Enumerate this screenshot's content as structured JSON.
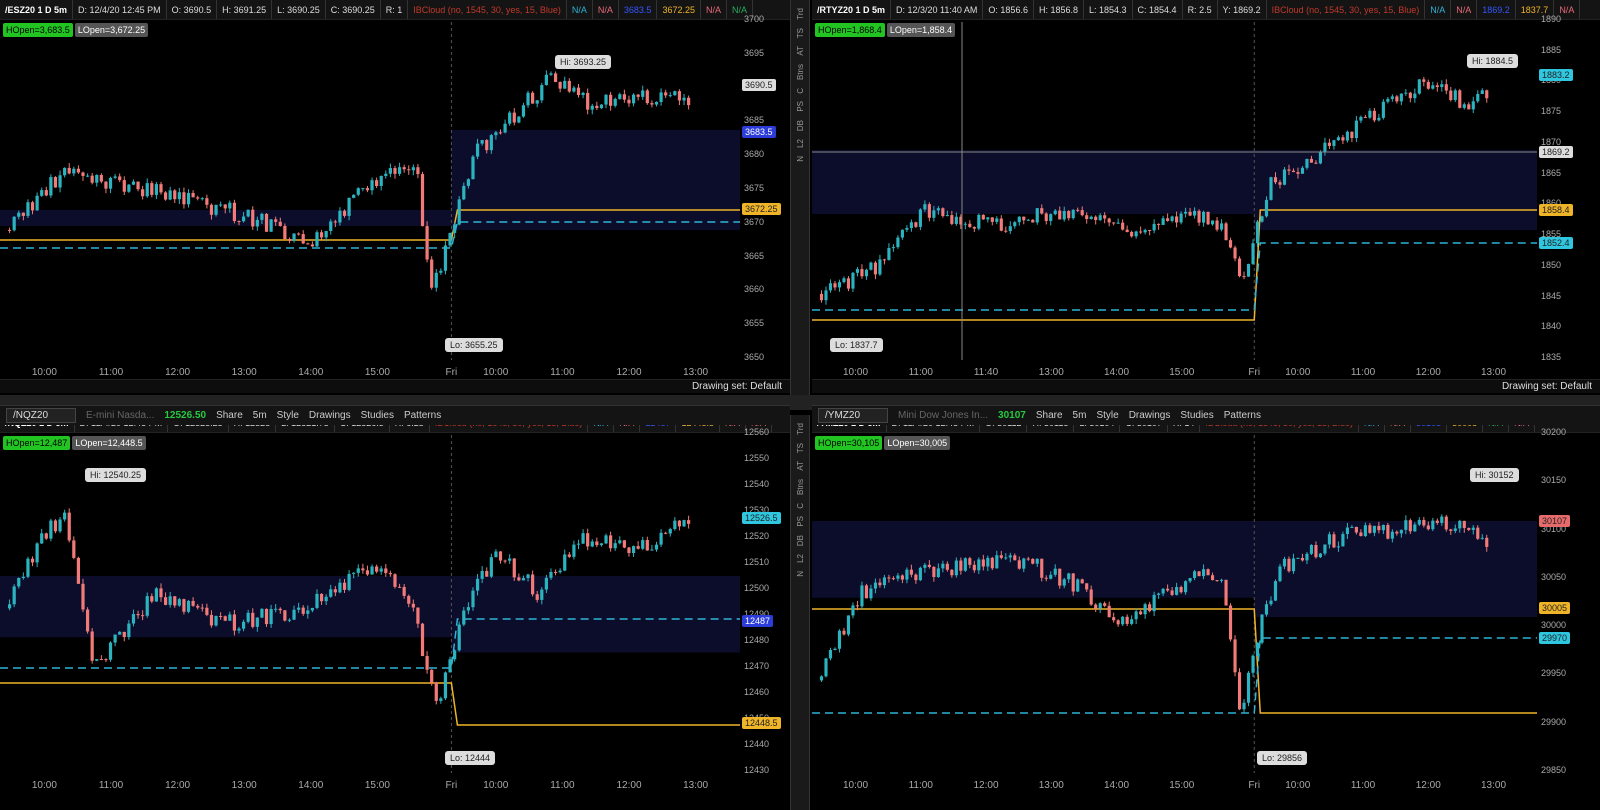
{
  "panes": [
    {
      "id": "es",
      "info": [
        "/ESZ20 1 D 5m",
        "D: 12/4/20 12:45 PM",
        "O: 3690.5",
        "H: 3691.25",
        "L: 3690.25",
        "C: 3690.25",
        "R: 1",
        "IBCloud (no, 1545, 30, yes, 15, Blue)",
        "N/A",
        "N/A",
        "3683.5",
        "3672.25",
        "N/A",
        "N/A"
      ],
      "info_colors": [
        "sym",
        "",
        "",
        "",
        "",
        "",
        "",
        "red",
        "cyan",
        "pink",
        "blue",
        "orange",
        "pink",
        "green"
      ],
      "hopen": "HOpen=3,683.5",
      "lopen": "LOpen=3,672.25",
      "hi": "Hi: 3693.25",
      "lo": "Lo: 3655.25",
      "yticks": [
        "3700",
        "3695",
        "3690",
        "3685",
        "3680",
        "3675",
        "3670",
        "3665",
        "3660",
        "3655",
        "3650"
      ],
      "xticks": [
        "10:00",
        "11:00",
        "12:00",
        "13:00",
        "14:00",
        "15:00",
        "Fri",
        "10:00",
        "11:00",
        "12:00",
        "13:00"
      ],
      "tags": [
        {
          "text": "3690.5",
          "bg": "#dddddd",
          "fg": "#222"
        },
        {
          "text": "3683.5",
          "bg": "#2b3cd8",
          "fg": "#fff"
        },
        {
          "text": "3672.25",
          "bg": "#f0b429",
          "fg": "#222"
        }
      ],
      "drawing_set": "Drawing set: Default"
    },
    {
      "id": "rty",
      "info": [
        "/RTYZ20 1 D 5m",
        "D: 12/3/20 11:40 AM",
        "O: 1856.6",
        "H: 1856.8",
        "L: 1854.3",
        "C: 1854.4",
        "R: 2.5",
        "Y: 1869.2",
        "IBCloud (no, 1545, 30, yes, 15, Blue)",
        "N/A",
        "N/A",
        "1869.2",
        "1837.7",
        "N/A"
      ],
      "info_colors": [
        "sym",
        "",
        "",
        "",
        "",
        "",
        "",
        "",
        "red",
        "cyan",
        "pink",
        "blue",
        "orange",
        "pink"
      ],
      "hopen": "HOpen=1,868.4",
      "lopen": "LOpen=1,858.4",
      "hi": "Hi: 1884.5",
      "lo": "Lo: 1837.7",
      "yticks": [
        "1890",
        "1885",
        "1880",
        "1875",
        "1870",
        "1865",
        "1860",
        "1855",
        "1850",
        "1845",
        "1840",
        "1835"
      ],
      "xticks": [
        "10:00",
        "11:00",
        "11:40",
        "13:00",
        "14:00",
        "15:00",
        "Fri",
        "10:00",
        "11:00",
        "12:00",
        "13:00"
      ],
      "tags": [
        {
          "text": "1883.2",
          "bg": "#2fc7e0",
          "fg": "#222"
        },
        {
          "text": "1869.2",
          "bg": "#dddddd",
          "fg": "#222"
        },
        {
          "text": "1858.4",
          "bg": "#f0b429",
          "fg": "#222"
        },
        {
          "text": "1852.4",
          "bg": "#2fc7e0",
          "fg": "#222"
        }
      ],
      "drawing_set": "Drawing set: Default"
    },
    {
      "id": "nq",
      "info": [
        "/NQZ20 1 D 5m",
        "D: 12/4/20 12:45 PM",
        "O: 12525.25",
        "H: 12528",
        "L: 12521.75",
        "C: 12526.5",
        "R: 6.25",
        "IBCloud (no, 1545, 30, yes, 15, Blue)",
        "N/A",
        "N/A",
        "12487",
        "12448.5",
        "N/A",
        "N/A"
      ],
      "info_colors": [
        "sym",
        "",
        "",
        "",
        "",
        "",
        "",
        "red",
        "cyan",
        "pink",
        "blue",
        "orange",
        "pink",
        "pink"
      ],
      "hopen": "HOpen=12,487",
      "lopen": "LOpen=12,448.5",
      "hi": "Hi: 12540.25",
      "lo": "Lo: 12444",
      "yticks": [
        "12560",
        "12550",
        "12540",
        "12530",
        "12520",
        "12510",
        "12500",
        "12490",
        "12480",
        "12470",
        "12460",
        "12450",
        "12440",
        "12430"
      ],
      "xticks": [
        "10:00",
        "11:00",
        "12:00",
        "13:00",
        "14:00",
        "15:00",
        "Fri",
        "10:00",
        "11:00",
        "12:00",
        "13:00"
      ],
      "tags": [
        {
          "text": "12526.5",
          "bg": "#2fc7e0",
          "fg": "#222"
        },
        {
          "text": "12487",
          "bg": "#2b3cd8",
          "fg": "#fff"
        },
        {
          "text": "12448.5",
          "bg": "#f0b429",
          "fg": "#222"
        }
      ],
      "toolbar": {
        "symbol": "/NQZ20",
        "desc": "E-mini Nasda...",
        "price": "12526.50",
        "share": "Share",
        "interval": "5m",
        "style": "Style",
        "drawings": "Drawings",
        "studies": "Studies",
        "patterns": "Patterns"
      }
    },
    {
      "id": "ym",
      "info": [
        "/YMZ20 1 D 5m",
        "D: 12/4/20 12:45 PM",
        "O: 30112",
        "H: 30118",
        "L: 30104",
        "C: 30107",
        "R: 14",
        "IBCloud (no, 1545, 30, yes, 15, Blue)",
        "N/A",
        "N/A",
        "30105",
        "30005",
        "N/A",
        "N/A"
      ],
      "info_colors": [
        "sym",
        "",
        "",
        "",
        "",
        "",
        "",
        "red",
        "cyan",
        "pink",
        "blue",
        "orange",
        "green",
        "pink"
      ],
      "hopen": "HOpen=30,105",
      "lopen": "LOpen=30,005",
      "hi": "Hi: 30152",
      "lo": "Lo: 29856",
      "yticks": [
        "30200",
        "30150",
        "30100",
        "30050",
        "30000",
        "29950",
        "29900",
        "29850"
      ],
      "xticks": [
        "10:00",
        "11:00",
        "12:00",
        "13:00",
        "14:00",
        "15:00",
        "Fri",
        "10:00",
        "11:00",
        "12:00",
        "13:00"
      ],
      "tags": [
        {
          "text": "30107",
          "bg": "#e86b6b",
          "fg": "#222"
        },
        {
          "text": "30005",
          "bg": "#f0b429",
          "fg": "#222"
        },
        {
          "text": "29970",
          "bg": "#2fc7e0",
          "fg": "#222"
        }
      ],
      "toolbar": {
        "symbol": "/YMZ20",
        "desc": "Mini Dow Jones In...",
        "price": "30107",
        "share": "Share",
        "interval": "5m",
        "style": "Style",
        "drawings": "Drawings",
        "studies": "Studies",
        "patterns": "Patterns"
      }
    }
  ],
  "sidebar_tabs": [
    "Trd",
    "TS",
    "AT",
    "Btns",
    "C",
    "PS",
    "DB",
    "L2",
    "N"
  ],
  "colors": {
    "up": "#2bb3c0",
    "down": "#f27a78",
    "cloud": "#0b0d2a",
    "orange": "#f0b429",
    "cyan": "#2fb3d6"
  }
}
